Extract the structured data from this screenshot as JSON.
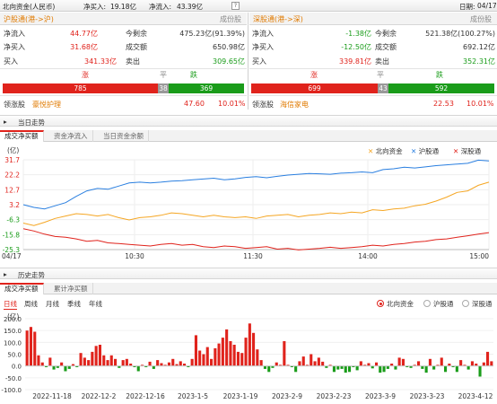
{
  "topbar": {
    "title": "北向资金(人民币)",
    "buy_label": "净买入:",
    "buy_value": "19.18亿",
    "inflow_label": "净流入:",
    "inflow_value": "43.39亿",
    "help": "?",
    "date_label": "日期:",
    "date_value": "04/17"
  },
  "sh": {
    "title": "沪股通(港->沪)",
    "components": "成份股",
    "rows": [
      {
        "l1": "净流入",
        "v1": "44.77亿",
        "c1": "red",
        "l2": "今剩余",
        "v2": "475.23亿(91.39%)",
        "c2": "dark"
      },
      {
        "l1": "净买入",
        "v1": "31.68亿",
        "c1": "red",
        "l2": "成交额",
        "v2": "650.98亿",
        "c2": "dark"
      },
      {
        "l1": "买入",
        "v1": "341.33亿",
        "c1": "red",
        "l2": "卖出",
        "v2": "309.65亿",
        "c2": "green"
      }
    ],
    "up_label": "涨",
    "flat_label": "平",
    "down_label": "跌",
    "up": "785",
    "flat": "38",
    "down": "369",
    "lead_label": "领涨股",
    "lead_name": "豪悦护理",
    "lead_price": "47.60",
    "lead_pct": "10.01%"
  },
  "sz": {
    "title": "深股通(港->深)",
    "components": "成份股",
    "rows": [
      {
        "l1": "净流入",
        "v1": "-1.38亿",
        "c1": "green",
        "l2": "今剩余",
        "v2": "521.38亿(100.27%)",
        "c2": "dark"
      },
      {
        "l1": "净买入",
        "v1": "-12.50亿",
        "c1": "green",
        "l2": "成交额",
        "v2": "692.12亿",
        "c2": "dark"
      },
      {
        "l1": "买入",
        "v1": "339.81亿",
        "c1": "red",
        "l2": "卖出",
        "v2": "352.31亿",
        "c2": "green"
      }
    ],
    "up_label": "涨",
    "flat_label": "平",
    "down_label": "跌",
    "up": "699",
    "flat": "43",
    "down": "592",
    "lead_label": "领涨股",
    "lead_name": "海信家电",
    "lead_price": "22.53",
    "lead_pct": "10.01%"
  },
  "intraday": {
    "section": "当日走势",
    "tabs": [
      "成交净买额",
      "资金净流入",
      "当日资金余额"
    ],
    "unit": "(亿)",
    "legend": [
      "北向资金",
      "沪股通",
      "深股通"
    ]
  },
  "history": {
    "section": "历史走势",
    "tabs": [
      "成交净买额",
      "累计净买额"
    ],
    "unit": "(亿)",
    "periods": [
      "日线",
      "周线",
      "月线",
      "季线",
      "年线"
    ],
    "radios": [
      "北向资金",
      "沪股通",
      "深股通"
    ]
  },
  "colors": {
    "north": "#f5a623",
    "sh": "#2a7fe0",
    "sz": "#e0231c",
    "up": "#e0231c",
    "down": "#1a9c1a"
  },
  "chart_data": [
    {
      "type": "line",
      "x_ticks": [
        "04/17",
        "10:30",
        "11:30",
        "14:00",
        "15:00"
      ],
      "y_ticks": [
        31.7,
        22.2,
        12.7,
        3.2,
        -6.3,
        -15.8,
        -25.3
      ],
      "ylim": [
        -25.3,
        31.7
      ],
      "series": [
        {
          "name": "沪股通",
          "values": [
            3.2,
            1.5,
            0.5,
            2.5,
            4.5,
            8.5,
            12.0,
            13.5,
            13.0,
            15.0,
            17.0,
            17.5,
            17.0,
            17.5,
            18.2,
            18.5,
            19.0,
            19.5,
            20.0,
            19.0,
            19.6,
            20.5,
            21.0,
            20.3,
            21.2,
            22.0,
            22.5,
            23.0,
            22.8,
            22.5,
            23.2,
            23.5,
            24.0,
            23.5,
            25.5,
            26.0,
            27.0,
            26.5,
            27.2,
            28.0,
            28.5,
            29.0,
            29.5,
            31.5,
            31.0
          ]
        },
        {
          "name": "北向资金",
          "values": [
            -8.5,
            -10.0,
            -8.0,
            -5.5,
            -4.0,
            -2.5,
            -3.0,
            -4.0,
            -3.0,
            -5.0,
            -6.5,
            -5.0,
            -4.5,
            -3.5,
            -2.0,
            -2.5,
            -3.5,
            -4.5,
            -3.5,
            -4.5,
            -5.0,
            -4.5,
            -5.5,
            -4.0,
            -3.5,
            -3.0,
            -4.5,
            -3.5,
            -3.0,
            -2.0,
            -2.5,
            -1.5,
            -2.0,
            0.0,
            -0.5,
            0.5,
            1.0,
            2.5,
            3.5,
            5.5,
            8.0,
            11.0,
            12.0,
            15.5,
            17.5
          ]
        },
        {
          "name": "深股通",
          "values": [
            -12.0,
            -13.5,
            -15.5,
            -17.0,
            -17.5,
            -18.5,
            -20.0,
            -19.5,
            -21.0,
            -21.5,
            -22.0,
            -22.5,
            -23.0,
            -22.0,
            -21.5,
            -22.5,
            -22.0,
            -23.5,
            -24.0,
            -23.0,
            -23.5,
            -24.5,
            -24.0,
            -23.5,
            -25.0,
            -24.5,
            -25.5,
            -25.0,
            -24.5,
            -23.8,
            -24.5,
            -24.0,
            -23.5,
            -22.5,
            -23.0,
            -22.0,
            -21.5,
            -20.5,
            -20.0,
            -19.0,
            -18.5,
            -17.5,
            -16.5,
            -15.5,
            -14.5
          ]
        }
      ]
    },
    {
      "type": "bar",
      "x_ticks": [
        "2022-11-18",
        "2022-12-2",
        "2022-12-16",
        "2023-1-5",
        "2023-1-19",
        "2023-2-9",
        "2023-2-23",
        "2023-3-9",
        "2023-3-23",
        "2023-4-12"
      ],
      "y_ticks": [
        200.0,
        150.0,
        100.0,
        50.0,
        0.0,
        -50.0,
        -100.0
      ],
      "ylim": [
        -100,
        200
      ],
      "values": [
        150,
        165,
        145,
        45,
        15,
        -5,
        35,
        -15,
        -8,
        15,
        -22,
        -12,
        8,
        -5,
        55,
        35,
        25,
        60,
        85,
        90,
        45,
        25,
        45,
        30,
        -8,
        25,
        30,
        10,
        -5,
        -22,
        5,
        -5,
        18,
        -12,
        25,
        12,
        5,
        15,
        30,
        8,
        20,
        10,
        -5,
        30,
        130,
        65,
        50,
        80,
        30,
        75,
        95,
        120,
        155,
        105,
        90,
        60,
        55,
        120,
        180,
        140,
        70,
        25,
        -12,
        -25,
        -8,
        15,
        5,
        105,
        5,
        -5,
        -25,
        20,
        40,
        5,
        50,
        20,
        35,
        18,
        -8,
        5,
        -25,
        -15,
        -12,
        -28,
        -25,
        -5,
        -18,
        20,
        5,
        12,
        -10,
        15,
        -28,
        -25,
        -12,
        10,
        -15,
        35,
        30,
        -5,
        -8,
        5,
        20,
        -12,
        -28,
        30,
        -15,
        5,
        35,
        -25,
        10,
        -5,
        -25,
        25,
        5,
        -15,
        20,
        10,
        -45,
        15,
        60,
        20
      ]
    }
  ]
}
